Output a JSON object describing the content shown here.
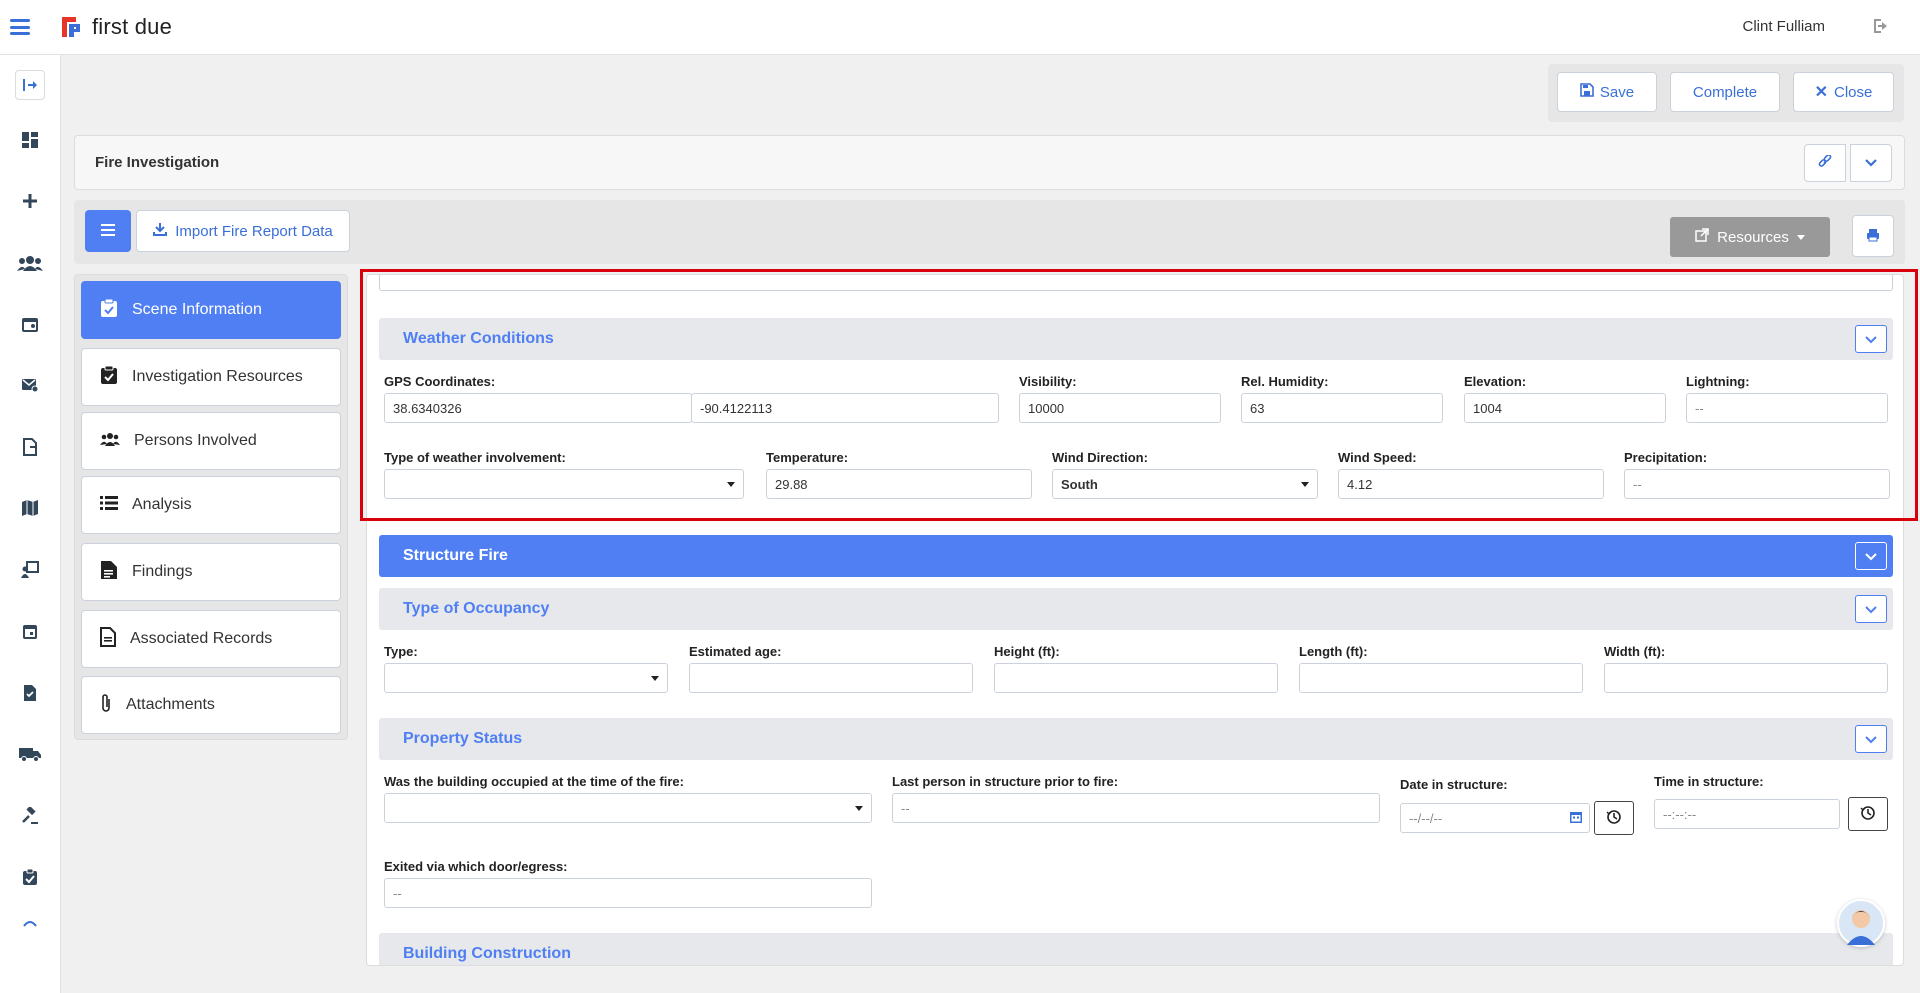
{
  "app": {
    "logo_text": "first due",
    "user_name": "Clint Fulliam"
  },
  "actions": {
    "save": "Save",
    "complete": "Complete",
    "close": "Close"
  },
  "header": {
    "title": "Fire Investigation"
  },
  "toolbar": {
    "import_label": "Import Fire Report Data",
    "resources_label": "Resources"
  },
  "nav": {
    "items": [
      {
        "label": "Scene Information",
        "icon": "clipboard-check-icon",
        "active": true
      },
      {
        "label": "Investigation Resources",
        "icon": "clipboard-check-icon",
        "active": false
      },
      {
        "label": "Persons Involved",
        "icon": "users-icon",
        "active": false
      },
      {
        "label": "Analysis",
        "icon": "list-icon",
        "active": false
      },
      {
        "label": "Findings",
        "icon": "file-text-icon",
        "active": false
      },
      {
        "label": "Associated Records",
        "icon": "file-icon",
        "active": false
      },
      {
        "label": "Attachments",
        "icon": "paperclip-icon",
        "active": false
      }
    ]
  },
  "weather": {
    "title": "Weather Conditions",
    "gps_label": "GPS Coordinates:",
    "gps_lat": "38.6340326",
    "gps_lon": "-90.4122113",
    "visibility_label": "Visibility:",
    "visibility": "10000",
    "humidity_label": "Rel. Humidity:",
    "humidity": "63",
    "elevation_label": "Elevation:",
    "elevation": "1004",
    "lightning_label": "Lightning:",
    "lightning": "--",
    "involvement_label": "Type of weather involvement:",
    "involvement": "",
    "temperature_label": "Temperature:",
    "temperature": "29.88",
    "wind_direction_label": "Wind Direction:",
    "wind_direction": "South",
    "wind_speed_label": "Wind Speed:",
    "wind_speed": "4.12",
    "precipitation_label": "Precipitation:",
    "precipitation": "--"
  },
  "structure": {
    "title": "Structure Fire"
  },
  "occupancy": {
    "title": "Type of Occupancy",
    "type_label": "Type:",
    "age_label": "Estimated age:",
    "height_label": "Height (ft):",
    "length_label": "Length (ft):",
    "width_label": "Width (ft):"
  },
  "property": {
    "title": "Property Status",
    "occupied_label": "Was the building occupied at the time of the fire:",
    "last_person_label": "Last person in structure prior to fire:",
    "last_person": "--",
    "date_label": "Date in structure:",
    "date_placeholder": "--/--/--",
    "time_label": "Time in structure:",
    "time_placeholder": "--:--:--",
    "exited_label": "Exited via which door/egress:",
    "exited": "--"
  },
  "construction": {
    "title": "Building Construction"
  }
}
